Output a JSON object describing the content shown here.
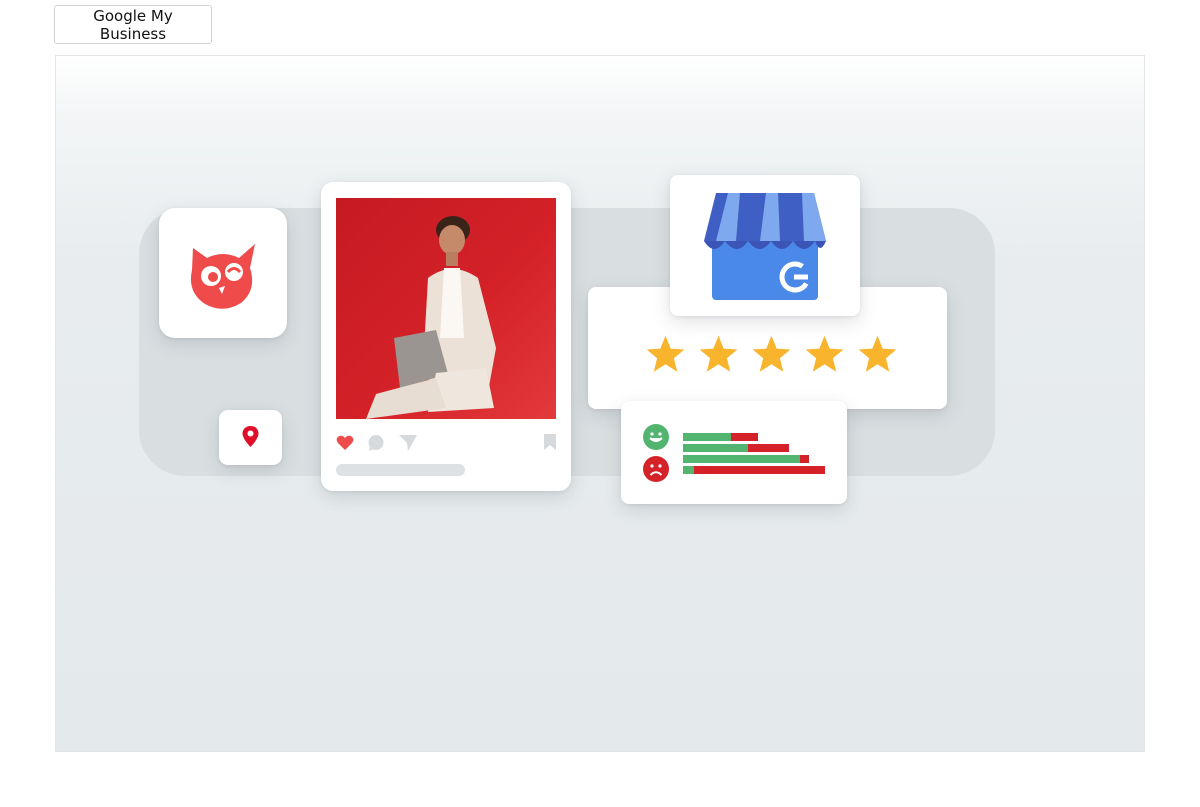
{
  "tab": {
    "label": "Google My Business"
  },
  "illustration": {
    "brand_color": "#ef4b4b",
    "pin_color": "#e0102a",
    "star_color": "#f7b42c",
    "positive_color": "#53b46f",
    "negative_color": "#d52128",
    "icons": [
      "owl-logo-icon",
      "location-pin-icon",
      "heart-icon",
      "comment-icon",
      "send-icon",
      "bookmark-icon",
      "google-my-business-store-icon",
      "star-icon",
      "smile-face-icon",
      "frown-face-icon"
    ],
    "rating_stars": 5,
    "sentiment_bars": [
      {
        "positive": 0.64,
        "negative": 0.36
      },
      {
        "positive": 0.61,
        "negative": 0.39
      },
      {
        "positive": 0.93,
        "negative": 0.07
      },
      {
        "positive": 0.08,
        "negative": 0.92
      }
    ]
  }
}
